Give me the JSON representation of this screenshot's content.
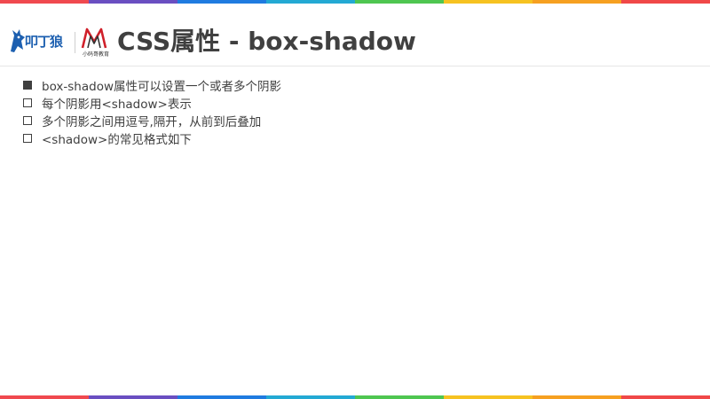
{
  "colors": {
    "stripe": [
      "#f0494f",
      "#6a4fc1",
      "#1f7be0",
      "#23a9d3",
      "#4fc651",
      "#f6c221",
      "#f6a021",
      "#f04848"
    ],
    "title": "#404040",
    "text": "#404040",
    "logo_blue": "#1c5fb0",
    "logo_red": "#d0202a"
  },
  "logo": {
    "mark_text": "叩丁狼",
    "partner_caption": "小码哥教育"
  },
  "slide": {
    "title": "CSS属性 - box-shadow",
    "bullets": [
      {
        "text": "box-shadow属性可以设置一个或者多个阴影",
        "marker": "filled-square-icon"
      },
      {
        "text": "每个阴影用<shadow>表示",
        "marker": "hollow-square-icon"
      },
      {
        "text": "多个阴影之间用逗号,隔开，从前到后叠加",
        "marker": "hollow-square-icon"
      },
      {
        "text": "<shadow>的常见格式如下",
        "marker": "hollow-square-icon"
      }
    ]
  }
}
